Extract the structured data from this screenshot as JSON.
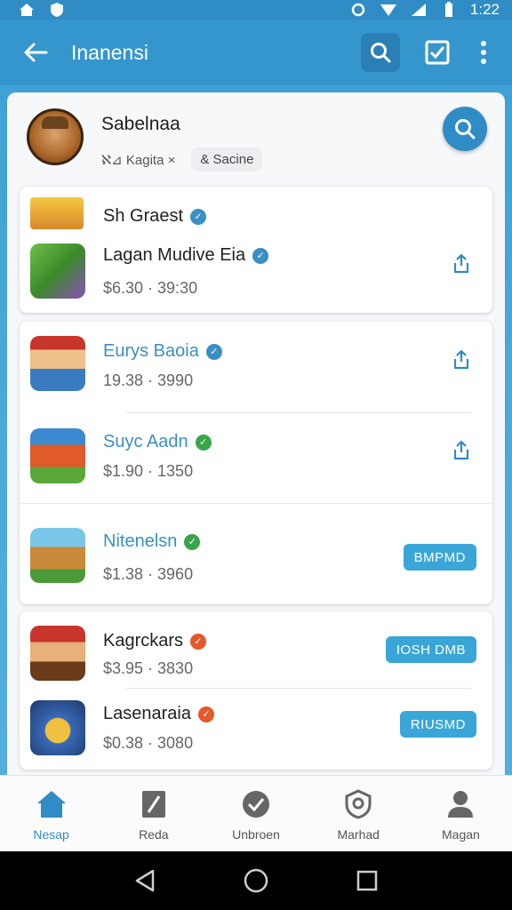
{
  "status": {
    "time": "1:22"
  },
  "app_bar": {
    "title": "Inanensi"
  },
  "profile": {
    "name": "Sabelnaa",
    "sub_text": "ℵ⊿ Kagita ×",
    "chip": "& Sacine"
  },
  "groups": [
    {
      "header": "Sh Graest",
      "items": [
        {
          "title": "Lagan Mudive Eia",
          "price": "$6.30 · 39:30",
          "action": "share",
          "badge_color": "#3a8fc5"
        }
      ]
    },
    {
      "items": [
        {
          "title": "Eurys Baoia",
          "price": "19.38 · 3990",
          "action": "share",
          "badge_color": "#3a8fc5"
        },
        {
          "title": "Suyc Aadn",
          "price": "$1.90 · 1350",
          "action": "share",
          "badge_color": "#3aa64a"
        },
        {
          "title": "Nitenelsn",
          "price": "$1.38 · 3960",
          "action": "pill",
          "pill_label": "BMPMD",
          "badge_color": "#3aa64a"
        }
      ]
    },
    {
      "items": [
        {
          "title": "Kagrckars",
          "price": "$3.95 · 3830",
          "action": "pill",
          "pill_label": "IOSH DMB",
          "badge_color": "#e5582a"
        },
        {
          "title": "Lasenaraia",
          "price": "$0.38 · 3080",
          "action": "pill",
          "pill_label": "RIUSMD",
          "badge_color": "#e5582a"
        }
      ]
    }
  ],
  "bottom_nav": [
    {
      "label": "Nesap",
      "icon": "home-icon",
      "active": true
    },
    {
      "label": "Reda",
      "icon": "document-icon",
      "active": false
    },
    {
      "label": "Unbroen",
      "icon": "check-badge-icon",
      "active": false
    },
    {
      "label": "Marhad",
      "icon": "settings-shield-icon",
      "active": false
    },
    {
      "label": "Magan",
      "icon": "person-icon",
      "active": false
    }
  ],
  "colors": {
    "primary": "#2f8cc4",
    "accent": "#3aa6d8",
    "link": "#3a8fc5"
  }
}
